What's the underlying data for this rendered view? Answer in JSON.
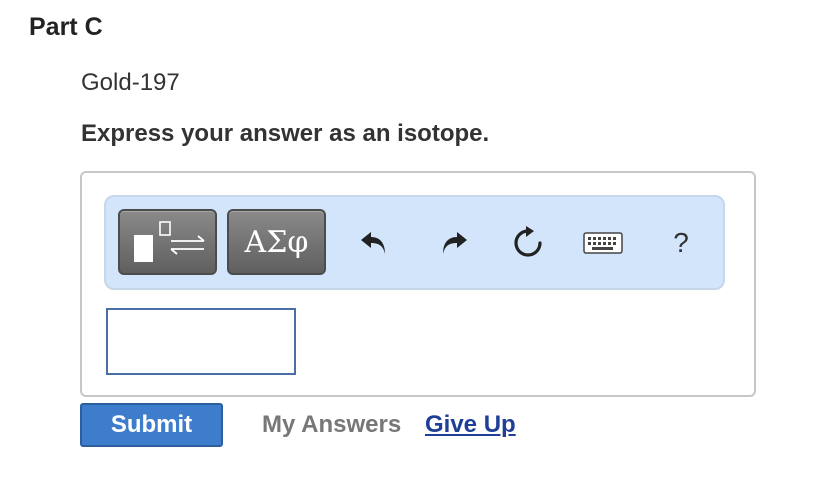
{
  "part": {
    "title": "Part C"
  },
  "question": {
    "text": "Gold-197",
    "instruction": "Express your answer as an isotope."
  },
  "toolbar": {
    "buttons": [
      {
        "icon": "template-icon"
      },
      {
        "icon": "greek-symbols-icon",
        "label": "ΑΣφ"
      },
      {
        "icon": "undo-icon"
      },
      {
        "icon": "redo-icon"
      },
      {
        "icon": "reset-icon"
      },
      {
        "icon": "keyboard-icon"
      },
      {
        "icon": "help-icon",
        "label": "?"
      }
    ],
    "colors": {
      "bar_background": "#d3e5fb",
      "button_dark": "#6e6e6e"
    }
  },
  "answer_input": {
    "value": ""
  },
  "actions": {
    "submit_label": "Submit",
    "my_answers_label": "My Answers",
    "give_up_label": "Give Up"
  },
  "colors": {
    "submit_button": "#3d7dcb",
    "give_up_link": "#1f3f97",
    "disabled_text": "#777777"
  }
}
